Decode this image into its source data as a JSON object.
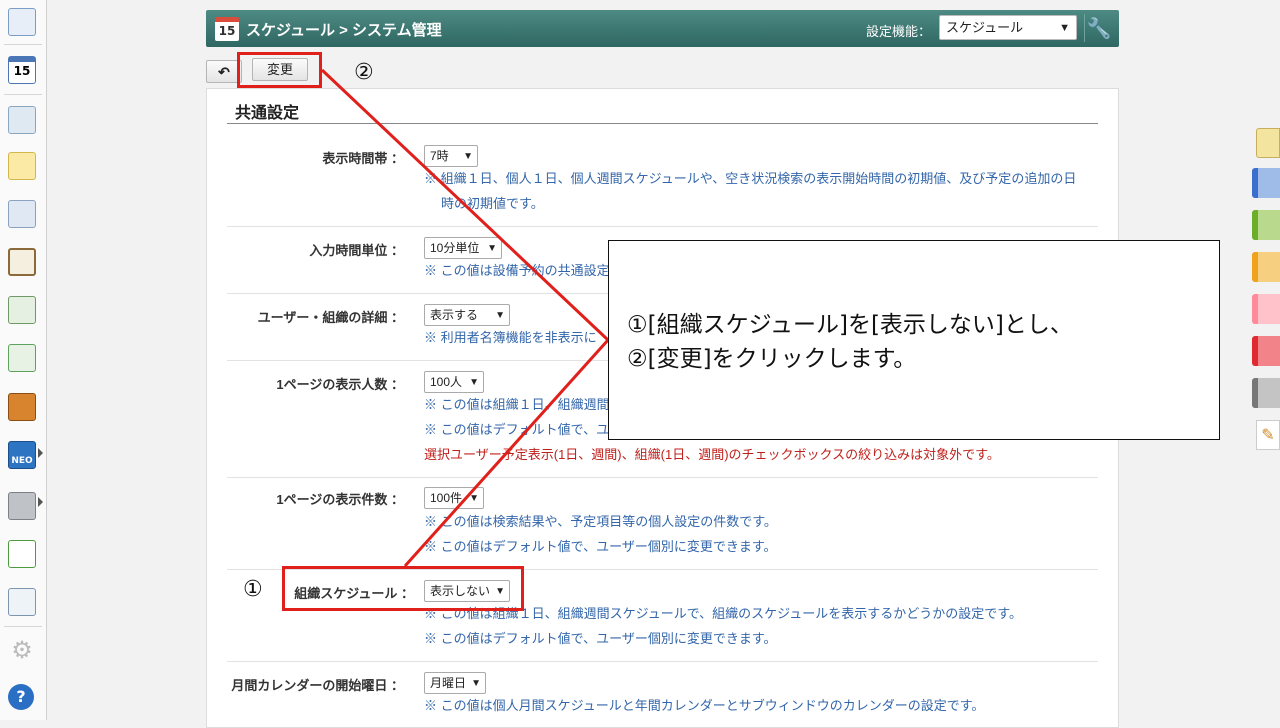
{
  "titlebar": {
    "calendar_icon_number": "15",
    "title": "スケジュール > システム管理",
    "settings_label": "設定機能：",
    "settings_select": "スケジュール"
  },
  "toolbar": {
    "change_button": "変更"
  },
  "section_title": "共通設定",
  "rows": [
    {
      "label": "表示時間帯 ：",
      "value": "7時",
      "notes": [
        "※ 組織１日、個人１日、個人週間スケジュールや、空き状況検索の表示開始時間の初期値、及び予定の追加の日",
        "時の初期値です。"
      ]
    },
    {
      "label": "入力時間単位 ：",
      "value": "10分単位",
      "notes": [
        "※ この値は設備予約の共通設定"
      ]
    },
    {
      "label": "ユーザー・組織の詳細 ：",
      "value": "表示する",
      "notes": [
        "※ 利用者名簿機能を非表示に"
      ]
    },
    {
      "label": "1ページの表示人数 ：",
      "value": "100人",
      "notes": [
        "※ この値は組織１日、組織週間",
        "※ この値はデフォルト値で、ユ",
        "選択ユーザー予定表示(1日、週間)、組織(1日、週間)のチェックボックスの絞り込みは対象外です。"
      ]
    },
    {
      "label": "1ページの表示件数 ：",
      "value": "100件",
      "notes": [
        "※ この値は検索結果や、予定項目等の個人設定の件数です。",
        "※ この値はデフォルト値で、ユーザー個別に変更できます。"
      ]
    },
    {
      "label": "組織スケジュール ：",
      "value": "表示しない",
      "notes": [
        "※ この値は組織１日、組織週間スケジュールで、組織のスケジュールを表示するかどうかの設定です。",
        "※ この値はデフォルト値で、ユーザー個別に変更できます。"
      ]
    },
    {
      "label": "月間カレンダーの開始曜日 ：",
      "value": "月曜日",
      "notes": [
        "※ この値は個人月間スケジュールと年間カレンダーとサブウィンドウのカレンダーの設定です。"
      ]
    }
  ],
  "annotations": {
    "marker_1": "①",
    "marker_2": "②",
    "callout_line1": "①[組織スケジュール]を[表示しない]とし、",
    "callout_line2": "②[変更]をクリックします。"
  },
  "sidebar": {
    "neo_label": "NEO",
    "help_label": "?"
  },
  "colors": {
    "titlebar": "#3d7a74",
    "annotation_red": "#e0201a",
    "note_blue": "#3366aa",
    "note_red": "#c0201b"
  }
}
